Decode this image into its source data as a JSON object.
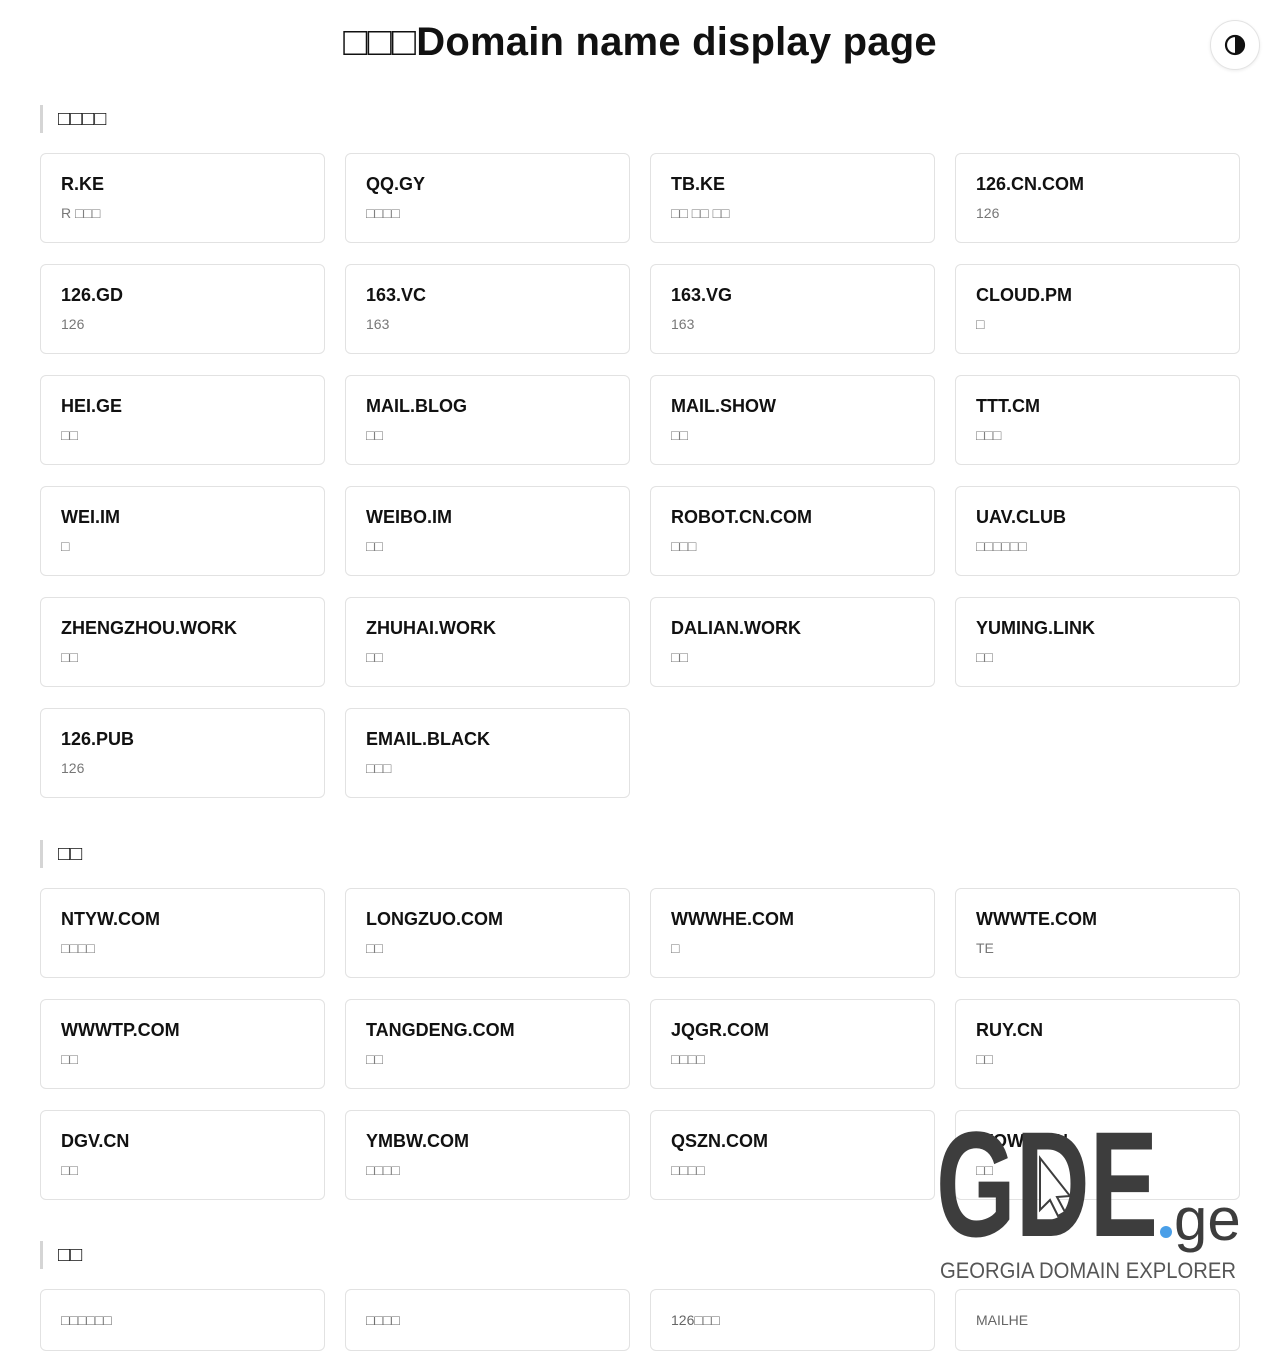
{
  "header": {
    "title": "□□□Domain name display page",
    "theme_toggle_icon": "contrast-icon"
  },
  "sections": [
    {
      "title": "□□□□",
      "cards": [
        {
          "name": "R.KE",
          "desc": "R □□□"
        },
        {
          "name": "QQ.GY",
          "desc": "□□□□"
        },
        {
          "name": "TB.KE",
          "desc": "□□ □□ □□"
        },
        {
          "name": "126.CN.COM",
          "desc": "126"
        },
        {
          "name": "126.GD",
          "desc": "126"
        },
        {
          "name": "163.VC",
          "desc": "163"
        },
        {
          "name": "163.VG",
          "desc": "163"
        },
        {
          "name": "CLOUD.PM",
          "desc": "□"
        },
        {
          "name": "HEI.GE",
          "desc": "□□"
        },
        {
          "name": "MAIL.BLOG",
          "desc": "□□"
        },
        {
          "name": "MAIL.SHOW",
          "desc": "□□"
        },
        {
          "name": "TTT.CM",
          "desc": "□□□"
        },
        {
          "name": "WEI.IM",
          "desc": "□"
        },
        {
          "name": "WEIBO.IM",
          "desc": "□□"
        },
        {
          "name": "ROBOT.CN.COM",
          "desc": "□□□"
        },
        {
          "name": "UAV.CLUB",
          "desc": "□□□□□□"
        },
        {
          "name": "ZHENGZHOU.WORK",
          "desc": "□□"
        },
        {
          "name": "ZHUHAI.WORK",
          "desc": "□□"
        },
        {
          "name": "DALIAN.WORK",
          "desc": "□□"
        },
        {
          "name": "YUMING.LINK",
          "desc": "□□"
        },
        {
          "name": "126.PUB",
          "desc": "126"
        },
        {
          "name": "EMAIL.BLACK",
          "desc": "□□□"
        }
      ]
    },
    {
      "title": "□□",
      "cards": [
        {
          "name": "NTYW.COM",
          "desc": "□□□□"
        },
        {
          "name": "LONGZUO.COM",
          "desc": "□□"
        },
        {
          "name": "WWWHE.COM",
          "desc": "□"
        },
        {
          "name": "WWWTE.COM",
          "desc": "TE"
        },
        {
          "name": "WWWTP.COM",
          "desc": "□□"
        },
        {
          "name": "TANGDENG.COM",
          "desc": "□□"
        },
        {
          "name": "JQGR.COM",
          "desc": "□□□□"
        },
        {
          "name": "RUY.CN",
          "desc": "□□"
        },
        {
          "name": "DGV.CN",
          "desc": "□□"
        },
        {
          "name": "YMBW.COM",
          "desc": "□□□□"
        },
        {
          "name": "QSZN.COM",
          "desc": "□□□□"
        },
        {
          "name": "WOWU.CN",
          "desc": "□□"
        }
      ]
    },
    {
      "title": "□□",
      "cards": [
        {
          "desc": "□□□□□□"
        },
        {
          "desc": "□□□□"
        },
        {
          "desc": "126□□□"
        },
        {
          "desc": "MAILHE"
        }
      ]
    }
  ],
  "watermark": {
    "logo_text": "GDE",
    "logo_suffix": "ge",
    "tagline": "GEORGIA DOMAIN EXPLORER",
    "accent_color": "#4a9fe8",
    "logo_color": "#3d3d3d"
  }
}
